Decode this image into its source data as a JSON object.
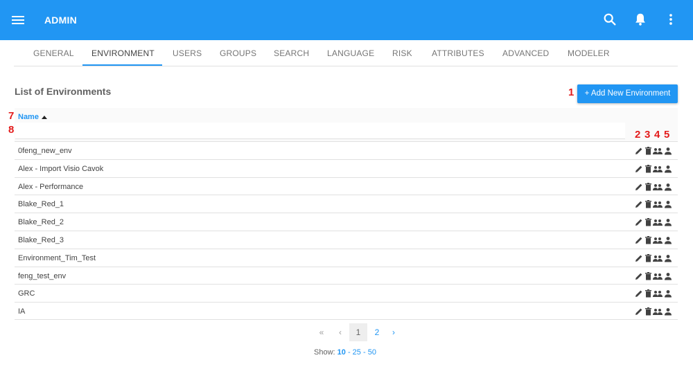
{
  "header": {
    "title": "ADMIN",
    "menu_icon": "hamburger-icon",
    "icons": [
      "search-icon",
      "bell-icon",
      "more-vert-icon"
    ],
    "color": "#2196f3"
  },
  "tabs": [
    {
      "label": "GENERAL",
      "active": false
    },
    {
      "label": "ENVIRONMENT",
      "active": true
    },
    {
      "label": "USERS",
      "active": false
    },
    {
      "label": "GROUPS",
      "active": false
    },
    {
      "label": "SEARCH",
      "active": false
    },
    {
      "label": "LANGUAGE",
      "active": false
    },
    {
      "label": "RISK",
      "active": false
    },
    {
      "label": "ATTRIBUTES",
      "active": false
    },
    {
      "label": "ADVANCED",
      "active": false
    },
    {
      "label": "MODELER",
      "active": false
    }
  ],
  "main": {
    "list_title": "List of Environments",
    "add_button_label": "+ Add New Environment",
    "column_name": "Name",
    "sort": "ascending",
    "filter_placeholder": "",
    "rows": [
      "0feng_new_env",
      "Alex - Import Visio Cavok",
      "Alex - Performance",
      "Blake_Red_1",
      "Blake_Red_2",
      "Blake_Red_3",
      "Environment_Tim_Test",
      "feng_test_env",
      "GRC",
      "IA"
    ],
    "row_action_icons": [
      "edit-icon",
      "delete-icon",
      "group-icon",
      "user-icon"
    ]
  },
  "annotations": {
    "n1": "1",
    "n2": "2",
    "n3": "3",
    "n4": "4",
    "n5": "5",
    "n7": "7",
    "n8": "8"
  },
  "pagination": {
    "first": "«",
    "prev": "‹",
    "pages": [
      "1",
      "2"
    ],
    "current": "1",
    "next": "›",
    "show_label": "Show:",
    "sizes": [
      "10",
      "25",
      "50"
    ],
    "selected_size": "10",
    "separator": " - "
  }
}
